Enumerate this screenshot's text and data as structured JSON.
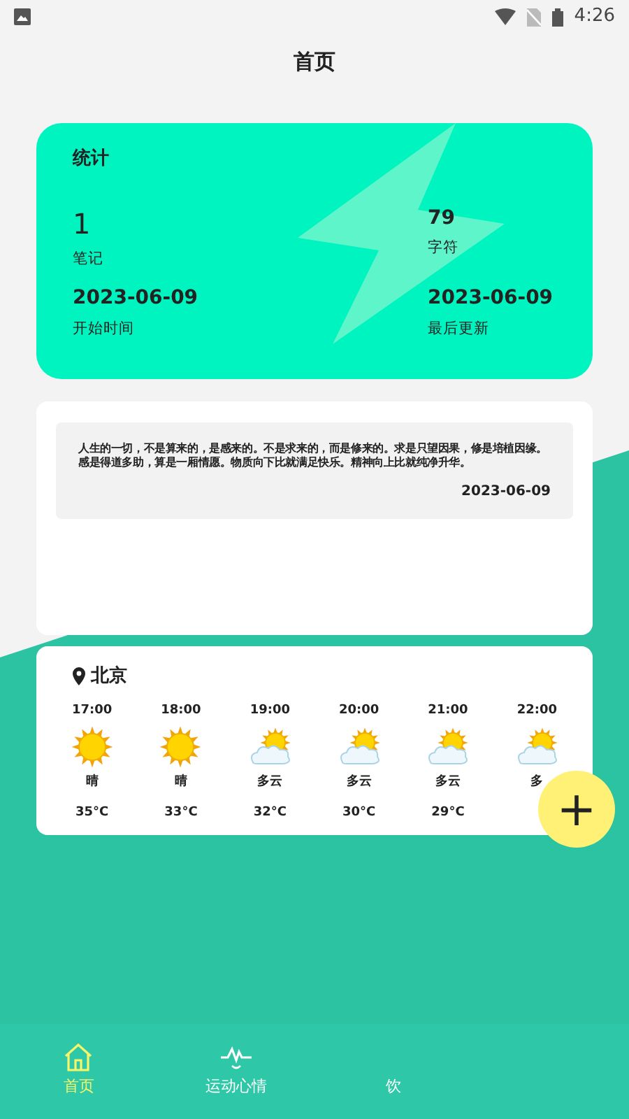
{
  "status_bar": {
    "time": "4:26"
  },
  "header": {
    "title": "首页"
  },
  "stats": {
    "title": "统计",
    "items": [
      {
        "value": "1",
        "label": "笔记",
        "big": true
      },
      {
        "value": "79",
        "label": "字符",
        "big": false
      },
      {
        "value": "2023-06-09",
        "label": "开始时间",
        "big": false
      },
      {
        "value": "2023-06-09",
        "label": "最后更新",
        "big": false
      }
    ]
  },
  "quote": {
    "text": "人生的一切，不是算来的，是感来的。不是求来的，而是修来的。求是只望因果，修是培植因缘。感是得道多助，算是一厢情愿。物质向下比就满足快乐。精神向上比就纯净升华。",
    "date": "2023-06-09"
  },
  "weather": {
    "city": "北京",
    "hours": [
      {
        "time": "17:00",
        "kind": "sunny",
        "condition": "晴",
        "temp": "35°C"
      },
      {
        "time": "18:00",
        "kind": "sunny",
        "condition": "晴",
        "temp": "33°C"
      },
      {
        "time": "19:00",
        "kind": "cloudy",
        "condition": "多云",
        "temp": "32°C"
      },
      {
        "time": "20:00",
        "kind": "cloudy",
        "condition": "多云",
        "temp": "30°C"
      },
      {
        "time": "21:00",
        "kind": "cloudy",
        "condition": "多云",
        "temp": "29°C"
      },
      {
        "time": "22:00",
        "kind": "cloudy",
        "condition": "多"
      }
    ]
  },
  "fab": {
    "label": "+"
  },
  "tabs": [
    {
      "label": "首页",
      "kind": "home",
      "selected": true
    },
    {
      "label": "运动心情",
      "kind": "pulse",
      "selected": false
    },
    {
      "label": "饮",
      "kind": "none",
      "selected": false
    }
  ]
}
